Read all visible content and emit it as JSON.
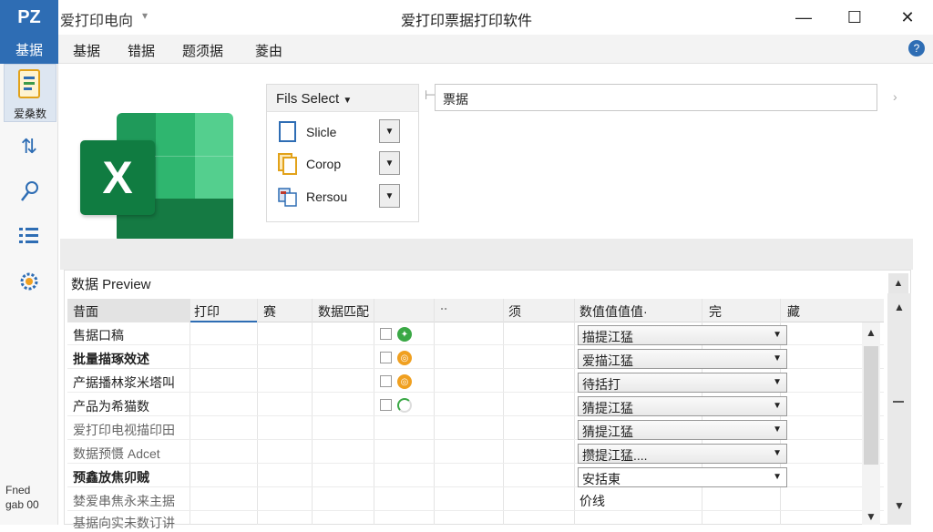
{
  "window": {
    "logo": "PZ",
    "document_title": "爱打印电向",
    "app_title": "爱打印票据打印软件",
    "controls": {
      "minimize": "—",
      "maximize": "☐",
      "close": "✕"
    }
  },
  "menu": {
    "active": "基据",
    "items": [
      "基据",
      "错据",
      "题须据",
      "菱由"
    ]
  },
  "sidebar": {
    "active_label": "爱桑数",
    "icons": [
      "document-icon",
      "sort-icon",
      "pin-icon",
      "grid-icon",
      "settings-icon"
    ],
    "footer": [
      "Fned",
      "gab 00"
    ]
  },
  "file_select": {
    "title": "Fils Select",
    "rows": [
      {
        "label": "Slicle",
        "icon": "file-icon"
      },
      {
        "label": "Corop",
        "icon": "copy-icon"
      },
      {
        "label": "Rersou",
        "icon": "template-icon"
      }
    ]
  },
  "search": {
    "value": "票据"
  },
  "preview": {
    "title": "数据 Preview",
    "columns": [
      "昔面",
      "打印",
      "赛",
      "数据匹配",
      "",
      "⠒",
      "须",
      "数值值值值·",
      "完",
      "藏"
    ],
    "rows": [
      {
        "name": "售据口稿",
        "checkbox": true,
        "status": "green",
        "select": "描提江猛",
        "muted": false
      },
      {
        "name": "批量描琢效述",
        "checkbox": true,
        "status": "orange",
        "select": "爱描江猛",
        "muted": false
      },
      {
        "name": "产据播林浆米塔叫",
        "checkbox": true,
        "status": "orange",
        "select": "待括打",
        "muted": false
      },
      {
        "name": "产品为希猫数",
        "checkbox": true,
        "status": "loading",
        "select": "猜提江猛",
        "muted": false
      },
      {
        "name": "爱打印电视描印田",
        "checkbox": false,
        "status": "",
        "select": "猜提江猛",
        "muted": true
      },
      {
        "name": "数据预慑 Adcet",
        "checkbox": false,
        "status": "",
        "select": "攒提江猛....",
        "muted": true
      },
      {
        "name": "预鑫放焦卯贼",
        "checkbox": false,
        "status": "",
        "select": "安括東",
        "muted": false
      },
      {
        "name": "婪爱串焦永来主据",
        "checkbox": false,
        "status": "",
        "select": "价线",
        "muted": true,
        "plain": true
      },
      {
        "name": "基据向实未数订讲",
        "checkbox": false,
        "status": "",
        "select": "",
        "muted": true,
        "plain": true
      }
    ]
  },
  "colors": {
    "accent": "#2e6db4",
    "excel_green": "#107c41"
  }
}
